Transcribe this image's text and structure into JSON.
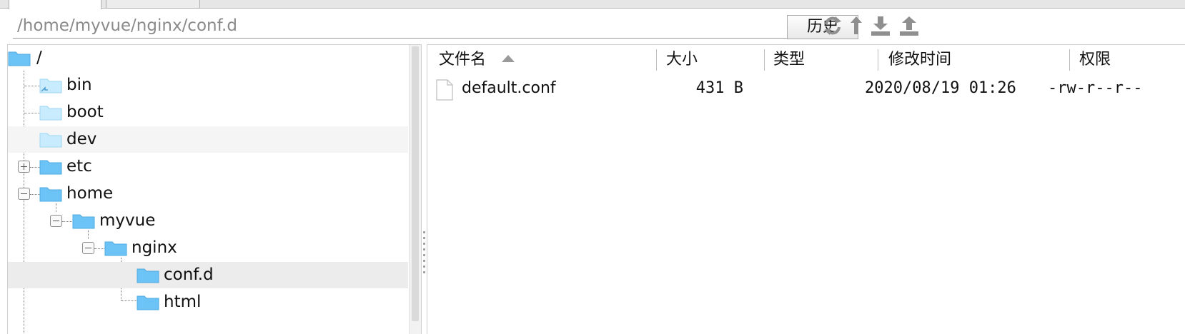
{
  "path_bar": {
    "value": "/home/myvue/nginx/conf.d"
  },
  "toolbar": {
    "history_label": "历史"
  },
  "tree": {
    "root": "/",
    "items": [
      {
        "label": "bin"
      },
      {
        "label": "boot"
      },
      {
        "label": "dev"
      },
      {
        "label": "etc"
      },
      {
        "label": "home"
      },
      {
        "label": "myvue"
      },
      {
        "label": "nginx"
      },
      {
        "label": "conf.d"
      },
      {
        "label": "html"
      }
    ]
  },
  "file_table": {
    "columns": [
      "文件名",
      "大小",
      "类型",
      "修改时间",
      "权限"
    ],
    "sort_column": "文件名",
    "rows": [
      {
        "name": "default.conf",
        "size": "431 B",
        "type": "",
        "modified": "2020/08/19 01:26",
        "permissions": "-rw-r--r--"
      }
    ]
  },
  "colors": {
    "folder": "#6cc4f6",
    "folder_light": "#c8ecfd",
    "selected_row": "#ececec"
  }
}
